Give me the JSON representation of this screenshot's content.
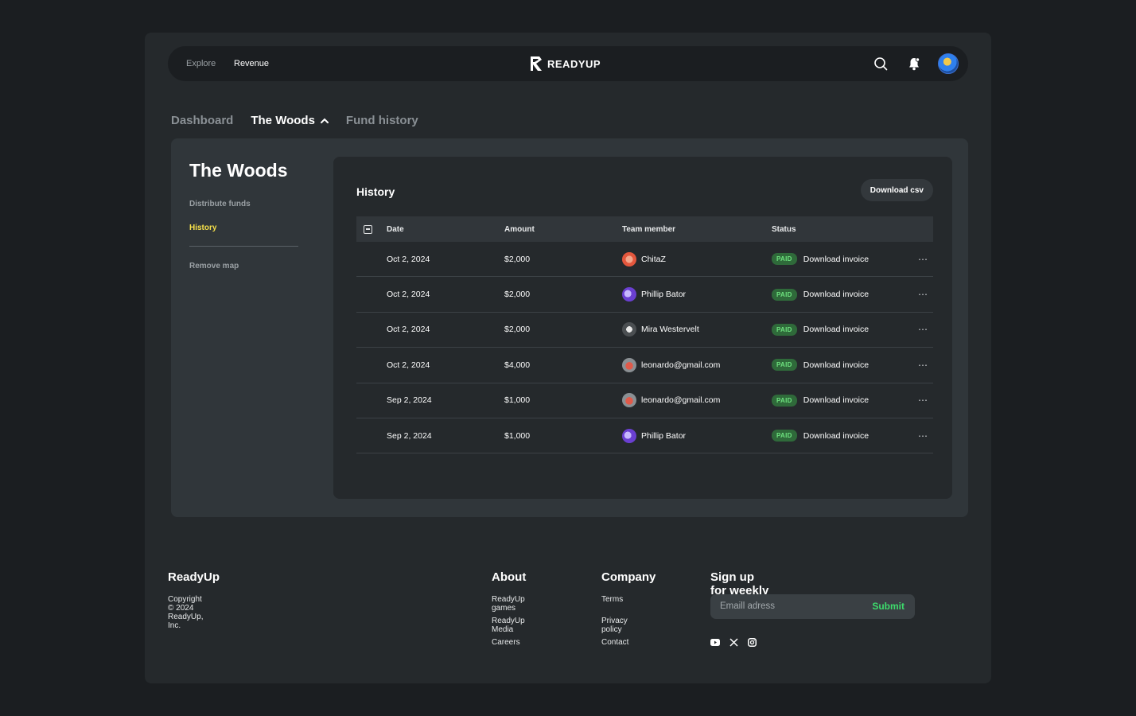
{
  "nav": {
    "explore": "Explore",
    "revenue": "Revenue",
    "brand": "READYUP",
    "icons": [
      "search-icon",
      "bell-icon",
      "avatar"
    ]
  },
  "tabs": [
    {
      "label": "Dashboard",
      "active": false
    },
    {
      "label": "The Woods",
      "active": true
    },
    {
      "label": "Fund history",
      "active": false
    }
  ],
  "sidebar": {
    "title": "The Woods",
    "items": [
      {
        "label": "Distribute funds",
        "active": false
      },
      {
        "label": "History",
        "active": true
      },
      {
        "label": "Remove map",
        "active": false
      }
    ]
  },
  "history": {
    "title": "History",
    "download_csv": "Download csv",
    "columns": [
      "Date",
      "Amount",
      "Team member",
      "Status"
    ],
    "rows": [
      {
        "date": "Oct 2, 2024",
        "amount": "$2,000",
        "member": "ChitaZ",
        "status": "PAID",
        "action": "Download invoice"
      },
      {
        "date": "Oct 2, 2024",
        "amount": "$2,000",
        "member": "Phillip Bator",
        "status": "PAID",
        "action": "Download invoice"
      },
      {
        "date": "Oct 2, 2024",
        "amount": "$2,000",
        "member": "Mira Westervelt",
        "status": "PAID",
        "action": "Download invoice"
      },
      {
        "date": "Oct 2, 2024",
        "amount": "$4,000",
        "member": "leonardo@gmail.com",
        "status": "PAID",
        "action": "Download invoice"
      },
      {
        "date": "Sep 2, 2024",
        "amount": "$1,000",
        "member": "leonardo@gmail.com",
        "status": "PAID",
        "action": "Download invoice"
      },
      {
        "date": "Sep 2, 2024",
        "amount": "$1,000",
        "member": "Phillip Bator",
        "status": "PAID",
        "action": "Download invoice"
      }
    ],
    "more": "⋯"
  },
  "footer": {
    "brand": "ReadyUp",
    "copyright": "Copyright © 2024 ReadyUp, Inc.",
    "about": {
      "title": "About",
      "links": [
        "ReadyUp games",
        "ReadyUp Media",
        "Careers"
      ]
    },
    "company": {
      "title": "Company",
      "links": [
        "Terms",
        "Privacy policy",
        "Contact"
      ]
    },
    "newsletter": {
      "title": "Sign up for weekly newsletter",
      "placeholder": "Emaill adress",
      "submit": "Submit"
    },
    "social_icons": [
      "youtube-icon",
      "x-icon",
      "instagram-icon"
    ]
  },
  "colors": {
    "background": "#1b1e21",
    "frame": "#25292c",
    "panel": "#30363a",
    "accent_yellow": "#f5e04a",
    "paid_green": "#6ee27f",
    "submit_green": "#3ddc6c"
  }
}
